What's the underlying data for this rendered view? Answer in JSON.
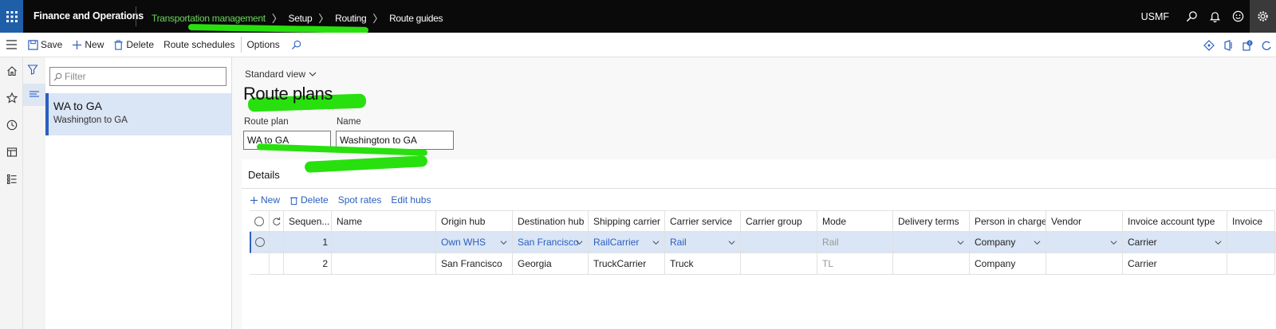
{
  "app": {
    "name": "Finance and Operations",
    "company": "USMF"
  },
  "breadcrumb": [
    "Transportation management",
    "Setup",
    "Routing",
    "Route guides"
  ],
  "toolbar": {
    "save": "Save",
    "new": "New",
    "delete": "Delete",
    "route_schedules": "Route schedules",
    "options": "Options"
  },
  "list": {
    "filter_placeholder": "Filter",
    "items": [
      {
        "title": "WA to GA",
        "subtitle": "Washington to GA"
      }
    ]
  },
  "page": {
    "view": "Standard view",
    "title": "Route plans"
  },
  "fields": {
    "route_plan_label": "Route plan",
    "route_plan_value": "WA to GA",
    "name_label": "Name",
    "name_value": "Washington to GA"
  },
  "details": {
    "title": "Details",
    "actions": {
      "new": "New",
      "delete": "Delete",
      "spot_rates": "Spot rates",
      "edit_hubs": "Edit hubs"
    },
    "columns": [
      "Sequen...",
      "Name",
      "Origin hub",
      "Destination hub",
      "Shipping carrier",
      "Carrier service",
      "Carrier group",
      "Mode",
      "Delivery terms",
      "Person in charge fo...",
      "Vendor",
      "Invoice account type",
      "Invoice"
    ],
    "rows": [
      {
        "seq": "1",
        "name": "",
        "origin": "Own WHS",
        "dest": "San Francisco",
        "carrier": "RailCarrier",
        "service": "Rail",
        "group": "",
        "mode": "Rail",
        "terms": "",
        "person": "Company",
        "vendor": "",
        "invoice_type": "Carrier"
      },
      {
        "seq": "2",
        "name": "",
        "origin": "San Francisco",
        "dest": "Georgia",
        "carrier": "TruckCarrier",
        "service": "Truck",
        "group": "",
        "mode": "TL",
        "terms": "",
        "person": "Company",
        "vendor": "",
        "invoice_type": "Carrier"
      }
    ]
  },
  "colors": {
    "accent": "#2a5fbf",
    "highlight": "#28e00e",
    "topbar": "#0a0a0a",
    "selected_row": "#dae5f5"
  }
}
